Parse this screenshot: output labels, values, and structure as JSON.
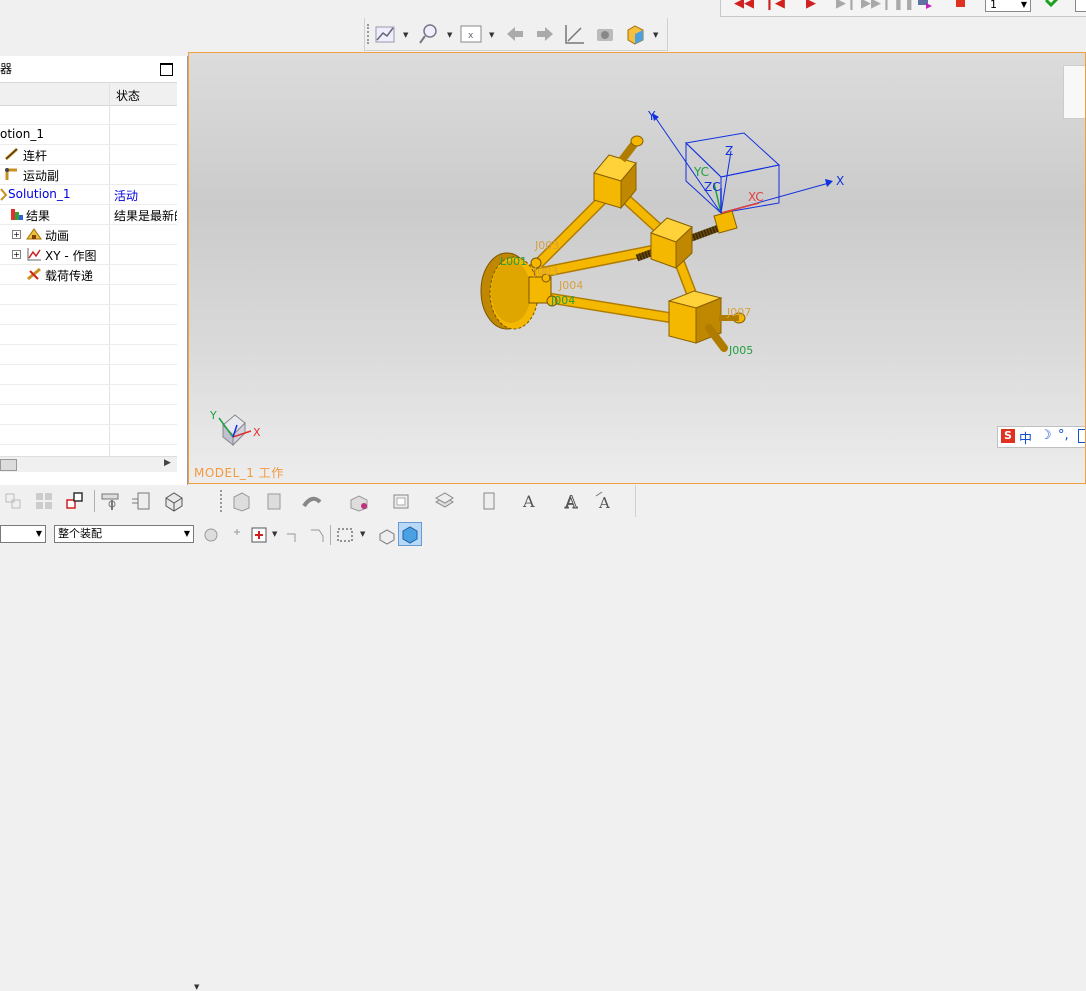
{
  "playback": {
    "frame_value": "1"
  },
  "navigator": {
    "title": "器",
    "column_status": "状态",
    "rows": [
      {
        "label": "",
        "status": ""
      },
      {
        "label": "otion_1",
        "status": ""
      },
      {
        "label": "连杆",
        "status": ""
      },
      {
        "label": "运动副",
        "status": ""
      },
      {
        "label": "Solution_1",
        "status": "活动"
      },
      {
        "label": "结果",
        "status": "结果是最新的"
      },
      {
        "label": "动画",
        "status": ""
      },
      {
        "label": "XY - 作图",
        "status": ""
      },
      {
        "label": "载荷传递",
        "status": ""
      }
    ]
  },
  "viewport": {
    "label": "MODEL_1 工作",
    "csys_labels": {
      "y": "Y",
      "yc": "YC",
      "z": "Z",
      "zc": "ZC",
      "xc": "XC",
      "x": "X"
    },
    "joint_labels": [
      "J003",
      "L001",
      "J003",
      "J004",
      "J004",
      "J007",
      "J005"
    ],
    "triad": {
      "x": "X",
      "y": "Y"
    },
    "ime_text": "中"
  },
  "bottom": {
    "select_left": "",
    "select_assembly": "整个装配"
  },
  "colors": {
    "model": "#f5b800",
    "model_dark": "#b07c00",
    "csys": "#1030e0",
    "accent_orange": "#f39a40",
    "status_blue": "#0000e0"
  }
}
